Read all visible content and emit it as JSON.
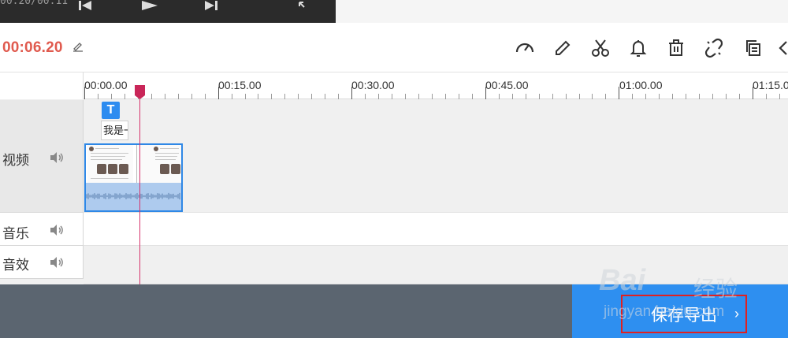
{
  "player": {
    "time": "00:20/00:11",
    "controls": [
      "skip-back-icon",
      "play-icon",
      "skip-forward-icon",
      "fullscreen-icon"
    ]
  },
  "toolbar": {
    "current_time": "00:06.20",
    "tools": [
      "speed-icon",
      "edit-pencil-icon",
      "scissors-icon",
      "bell-icon",
      "trash-icon",
      "unlink-icon",
      "copy-icon",
      "arrow-left-icon"
    ]
  },
  "ruler": {
    "labels": [
      "00:00.00",
      "00:15.00",
      "00:30.00",
      "00:45.00",
      "01:00.00",
      "01:15.0"
    ]
  },
  "tracks": {
    "video": {
      "label": "视频"
    },
    "music": {
      "label": "音乐"
    },
    "sfx": {
      "label": "音效"
    }
  },
  "text_clip": {
    "badge": "T",
    "text": "我是一"
  },
  "export": {
    "label": "保存导出",
    "arrow": "›"
  },
  "watermark": {
    "brand": "Bai",
    "brand_cn": "经验",
    "url": "jingyan.baidu.com"
  },
  "colors": {
    "accent": "#2e8ff0",
    "time_red": "#e05a4e",
    "playhead": "#d6336c",
    "bottom_bar": "#5b6570",
    "highlight_box": "#e02020"
  }
}
